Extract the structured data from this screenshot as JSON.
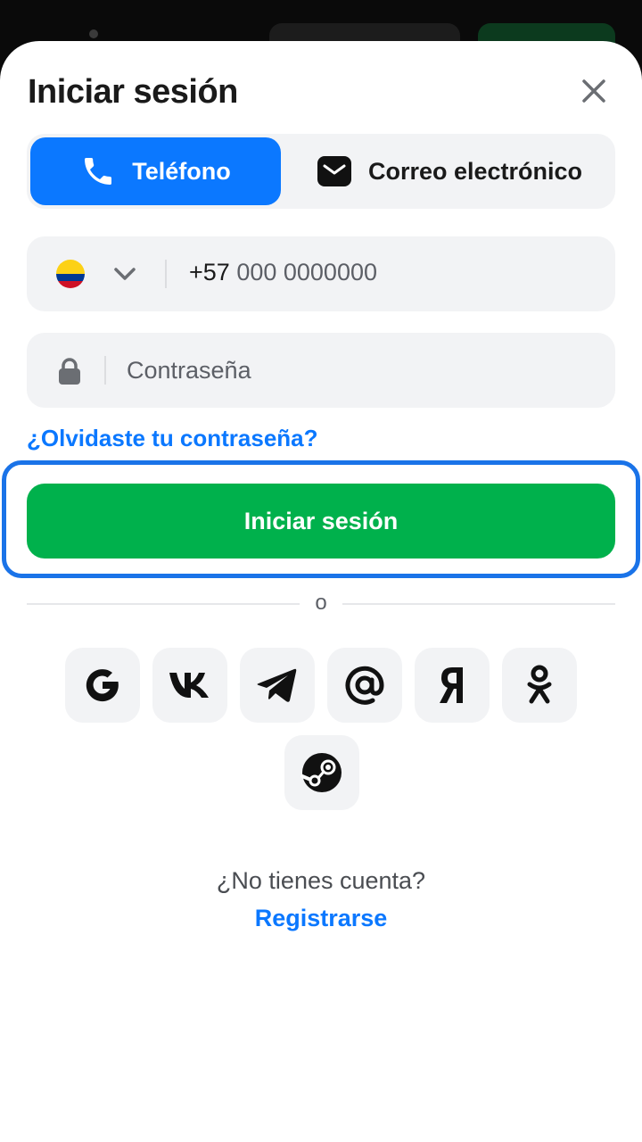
{
  "header": {
    "title": "Iniciar sesión"
  },
  "tabs": [
    {
      "label": "Teléfono",
      "icon": "phone-icon",
      "active": true
    },
    {
      "label": "Correo electrónico",
      "icon": "envelope-icon",
      "active": false
    }
  ],
  "phone": {
    "country_flag": "colombia-flag-icon",
    "prefix": "+57",
    "placeholder_rest": "000 0000000"
  },
  "password": {
    "placeholder": "Contraseña"
  },
  "forgot_label": "¿Olvidaste tu contraseña?",
  "login_label": "Iniciar sesión",
  "divider_label": "o",
  "social": [
    {
      "name": "google",
      "icon": "google-icon"
    },
    {
      "name": "vk",
      "icon": "vk-icon"
    },
    {
      "name": "telegram",
      "icon": "telegram-icon"
    },
    {
      "name": "mail-ru",
      "icon": "at-sign-icon"
    },
    {
      "name": "yandex",
      "icon": "yandex-icon"
    },
    {
      "name": "odnoklassniki",
      "icon": "odnoklassniki-icon"
    },
    {
      "name": "steam",
      "icon": "steam-icon"
    }
  ],
  "footer": {
    "prompt": "¿No tienes cuenta?",
    "register_label": "Registrarse"
  },
  "colors": {
    "primary": "#0b78ff",
    "success": "#00b14c",
    "focus": "#1a73e8",
    "field_bg": "#f2f3f5"
  }
}
